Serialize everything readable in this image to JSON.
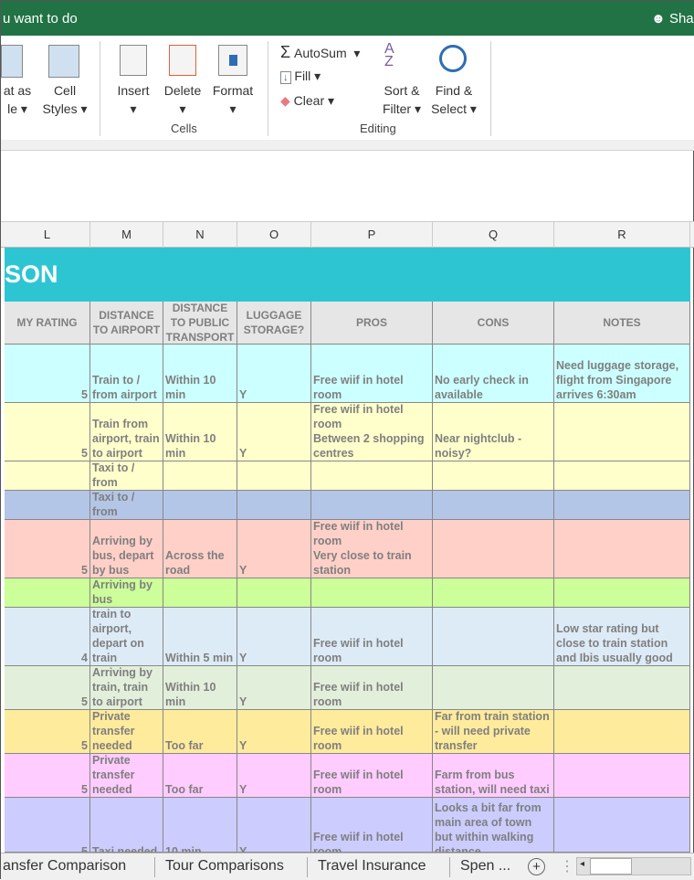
{
  "topbar": {
    "tell_me": "u want to do",
    "share": "Sha"
  },
  "ribbon": {
    "format_as": "at as",
    "format_as2": "le",
    "cell_styles": "Cell",
    "cell_styles2": "Styles",
    "insert": "Insert",
    "delete": "Delete",
    "format": "Format",
    "cells_group": "Cells",
    "autosum": "AutoSum",
    "fill": "Fill",
    "clear": "Clear",
    "sort": "Sort &",
    "sort2": "Filter",
    "find": "Find &",
    "find2": "Select",
    "editing_group": "Editing"
  },
  "columns": [
    "L",
    "M",
    "N",
    "O",
    "P",
    "Q",
    "R"
  ],
  "title": "SON",
  "headers": [
    "MY RATING",
    "DISTANCE TO AIRPORT",
    "DISTANCE TO PUBLIC TRANSPORT",
    "LUGGAGE STORAGE?",
    "PROS",
    "CONS",
    "NOTES"
  ],
  "rows": [
    {
      "color": "#ccffff",
      "cells": [
        "5",
        "Train to / from airport",
        "Within 10 min",
        "Y",
        "Free wiif in hotel room",
        "No early check in available",
        "Need luggage storage, flight from Singapore arrives 6:30am"
      ]
    },
    {
      "color": "#ffffcc",
      "cells": [
        "5",
        "Train from airport, train to airport",
        "Within 10 min",
        "Y",
        "Free wiif in hotel room\nBetween 2 shopping centres",
        "Near nightclub - noisy?",
        ""
      ]
    },
    {
      "color": "#ffffcc",
      "cells": [
        "",
        "Taxi to / from",
        "",
        "",
        "",
        "",
        ""
      ]
    },
    {
      "color": "#b4c6e7",
      "cells": [
        "",
        "Taxi to / from",
        "",
        "",
        "",
        "",
        ""
      ]
    },
    {
      "color": "#ffd0c8",
      "cells": [
        "5",
        "Arriving by bus, depart by bus",
        "Across the road",
        "Y",
        "Free wiif in hotel room\nVery close to train station",
        "",
        ""
      ]
    },
    {
      "color": "#ccff99",
      "cells": [
        "",
        "Arriving by bus",
        "",
        "",
        "",
        "",
        ""
      ]
    },
    {
      "color": "#ddebf7",
      "cells": [
        "4",
        "train to airport, depart on train",
        "Within 5 min",
        "Y",
        "Free wiif in hotel room",
        "",
        "Low star rating but close to train station and Ibis usually good"
      ]
    },
    {
      "color": "#e2efda",
      "cells": [
        "5",
        "Arriving by train, train to airport",
        "Within 10 min",
        "Y",
        "Free wiif in hotel room",
        "",
        ""
      ]
    },
    {
      "color": "#ffeb9c",
      "cells": [
        "5",
        "Private transfer needed",
        "Too far",
        "Y",
        "Free wiif in hotel room",
        "Far from train station - will need private transfer",
        ""
      ]
    },
    {
      "color": "#ffccff",
      "cells": [
        "5",
        "Private transfer needed",
        "Too far",
        "Y",
        "Free wiif in hotel room",
        "Farm from bus station, will need taxi",
        ""
      ]
    },
    {
      "color": "#ccccff",
      "cells": [
        "5",
        "Taxi needed",
        "10 min",
        "Y",
        "Free wiif in hotel room",
        "Looks a bit far from main area of town but within walking distance",
        ""
      ]
    }
  ],
  "tabs": [
    "ansfer Comparison",
    "Tour Comparisons",
    "Travel Insurance",
    "Spen ..."
  ]
}
